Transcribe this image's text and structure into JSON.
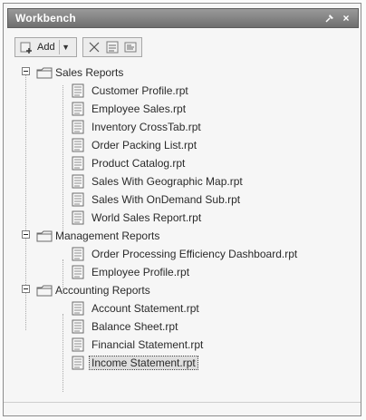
{
  "window": {
    "title": "Workbench"
  },
  "toolbar": {
    "add_label": "Add"
  },
  "tree": [
    {
      "folder": "Sales Reports",
      "items": [
        "Customer Profile.rpt",
        "Employee Sales.rpt",
        "Inventory CrossTab.rpt",
        "Order Packing List.rpt",
        "Product Catalog.rpt",
        "Sales With Geographic Map.rpt",
        "Sales With OnDemand Sub.rpt",
        "World Sales Report.rpt"
      ]
    },
    {
      "folder": "Management Reports",
      "items": [
        "Order Processing Efficiency Dashboard.rpt",
        "Employee Profile.rpt"
      ]
    },
    {
      "folder": "Accounting Reports",
      "items": [
        "Account Statement.rpt",
        "Balance Sheet.rpt",
        "Financial Statement.rpt",
        "Income Statement.rpt"
      ]
    }
  ],
  "icons": {
    "folder": "folder-icon",
    "report": "report-file-icon",
    "add": "add-icon",
    "toolbar_extra": "toolbar-icons"
  }
}
